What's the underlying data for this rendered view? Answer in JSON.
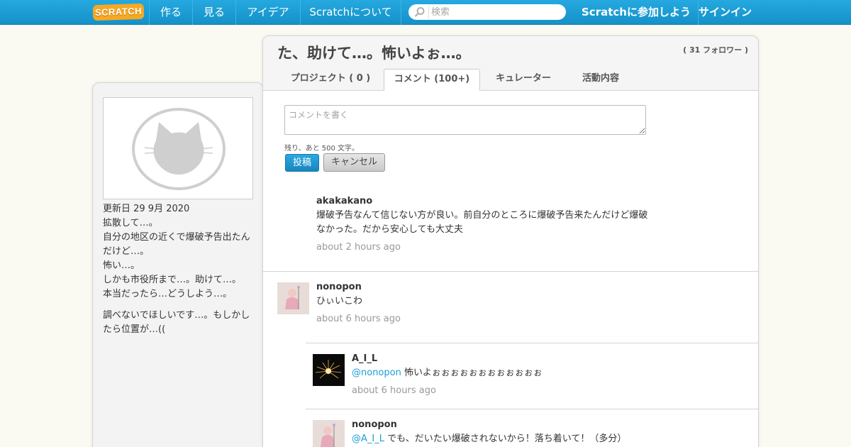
{
  "nav": {
    "logo": "SCRATCH",
    "create": "作る",
    "explore": "見る",
    "ideas": "アイデア",
    "about": "Scratchについて",
    "search_placeholder": "検索",
    "join": "Scratchに参加しよう",
    "signin": "サインイン"
  },
  "profile": {
    "updated": "更新日 29 9月 2020",
    "bio": [
      "拡散して…。\n自分の地区の近くで爆破予告出たんだけど…。\n怖い…。\nしかも市役所まで…。助けて…。\n本当だったら…どうしよう…。",
      "調べないでほしいです…。もしかしたら位置が…(("
    ]
  },
  "header": {
    "title": "た、助けて…。怖いよぉ…。",
    "followers": "( 31 フォロワー )",
    "tabs": {
      "projects": "プロジェクト ( 0 )",
      "comments": "コメント (100+)",
      "curator": "キュレーター",
      "activity": "活動内容"
    }
  },
  "composer": {
    "placeholder": "コメントを書く",
    "chars_left": "残り、あと 500 文字。",
    "post": "投稿",
    "cancel": "キャンセル"
  },
  "comments": [
    {
      "user": "akakakano",
      "text": "爆破予告なんて信じない方が良い。前自分のところに爆破予告来たんだけど爆破なかった。だから安心しても大丈夫",
      "time": "about 2 hours ago"
    },
    {
      "user": "nonopon",
      "text": "ひぃいこわ",
      "time": "about 6 hours ago"
    },
    {
      "user": "A_I_L",
      "mention": "@nonopon",
      "text": " 怖いよぉぉぉぉぉぉぉぉぉぉぉぉ",
      "time": "about 6 hours ago"
    },
    {
      "user": "nonopon",
      "mention": "@A_I_L",
      "text": " でも、だいたい爆破されないから！落ち着いて！（多分）",
      "time": ""
    }
  ],
  "colors": {
    "nav_bg": "#1aa0d8",
    "link": "#1aa0d8",
    "logo": "#f7a823",
    "page_bg": "#fbfaf2"
  }
}
